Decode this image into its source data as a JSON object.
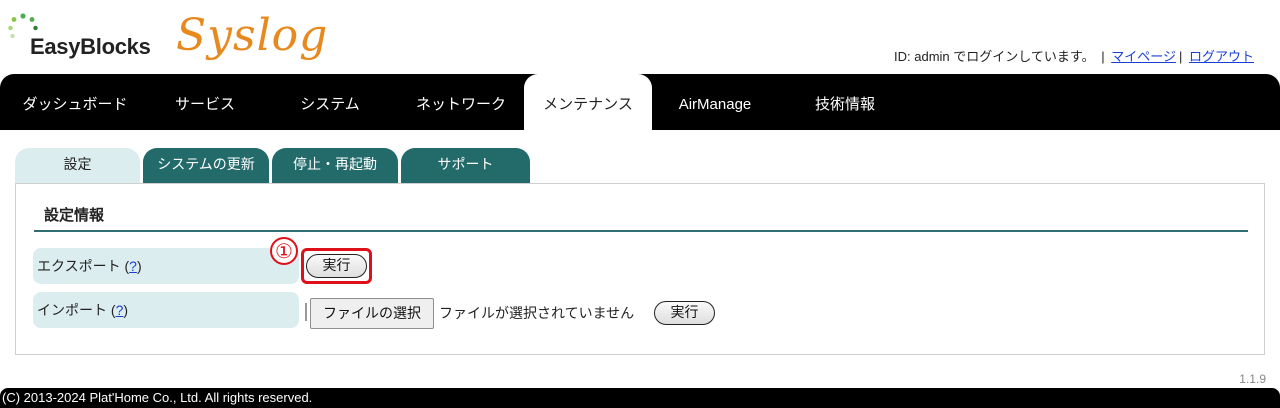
{
  "header": {
    "brand": "EasyBlocks",
    "product": "Syslog",
    "login_text": "ID: admin でログインしています。",
    "mypage_link": "マイページ",
    "logout_link": "ログアウト",
    "separator": "|"
  },
  "main_nav": {
    "items": [
      {
        "label": "ダッシュボード"
      },
      {
        "label": "サービス"
      },
      {
        "label": "システム"
      },
      {
        "label": "ネットワーク"
      },
      {
        "label": "メンテナンス",
        "active": true
      },
      {
        "label": "AirManage"
      },
      {
        "label": "技術情報"
      }
    ]
  },
  "sub_tabs": {
    "items": [
      {
        "label": "設定",
        "active": true
      },
      {
        "label": "システムの更新"
      },
      {
        "label": "停止・再起動"
      },
      {
        "label": "サポート"
      }
    ]
  },
  "panel": {
    "title": "設定情報",
    "export": {
      "label": "エクスポート",
      "help_open": "(",
      "help_link": "?",
      "help_close": ")",
      "run_button": "実行",
      "marker": "①"
    },
    "import": {
      "label": "インポート",
      "help_open": "(",
      "help_link": "?",
      "help_close": ")",
      "file_button": "ファイルの選択",
      "file_status": "ファイルが選択されていません",
      "run_button": "実行"
    }
  },
  "version": "1.1.9",
  "footer": {
    "copyright": "(C) 2013-2024 Plat'Home Co., Ltd. All rights reserved."
  },
  "colors": {
    "nav_bg": "#000000",
    "tab_active_bg": "#dcedef",
    "tab_inactive_bg": "#236b6b",
    "link": "#1a3fd6",
    "product_orange": "#e8891e",
    "highlight_red": "#e0101a"
  }
}
